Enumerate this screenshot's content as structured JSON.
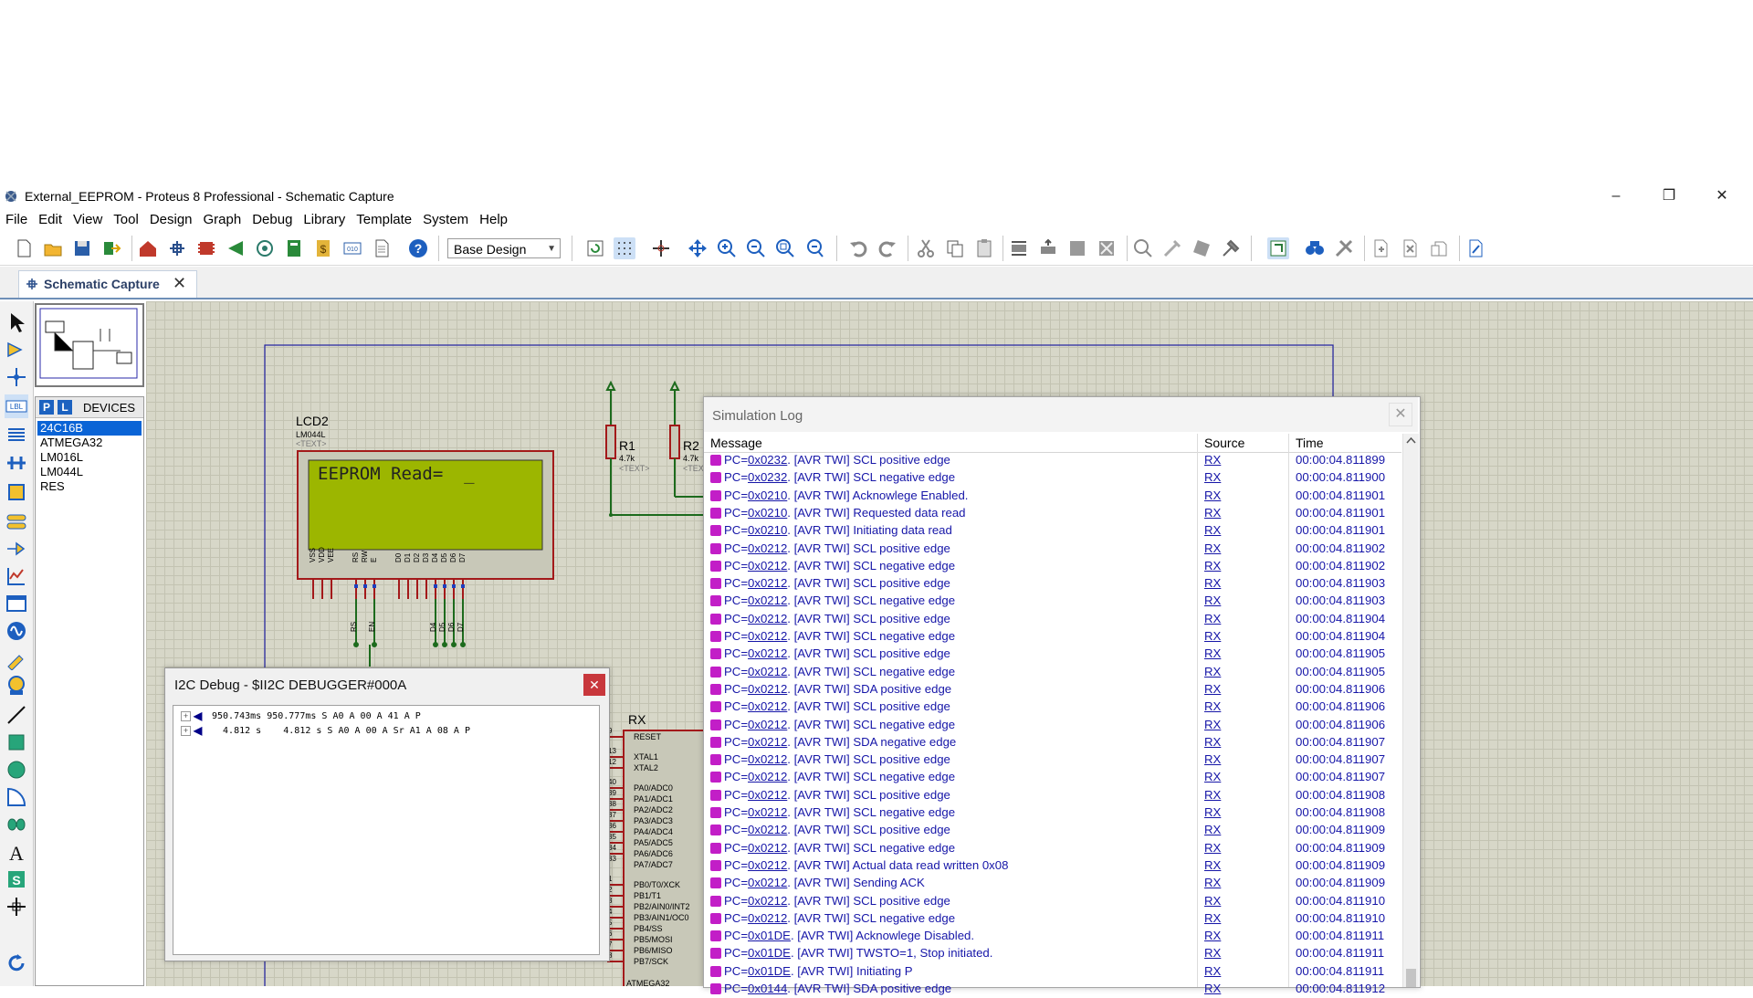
{
  "window": {
    "title": "External_EEPROM - Proteus 8 Professional - Schematic Capture",
    "minimize": "–",
    "restore": "❐",
    "close": "✕"
  },
  "menu": [
    "File",
    "Edit",
    "View",
    "Tool",
    "Design",
    "Graph",
    "Debug",
    "Library",
    "Template",
    "System",
    "Help"
  ],
  "toolbar": {
    "design_select": "Base Design",
    "icons": [
      "new-icon",
      "open-icon",
      "save-icon",
      "import-icon",
      "home-icon",
      "schematic-icon",
      "pcb-icon",
      "gerber-icon",
      "3d-icon",
      "bom-icon",
      "source-code-icon",
      "notes-icon",
      "help-icon",
      "refresh-icon",
      "grid-icon",
      "origin-icon",
      "pan-icon",
      "zoom-in-icon",
      "zoom-out-icon",
      "zoom-all-icon",
      "zoom-area-icon",
      "undo-icon",
      "redo-icon",
      "cut-icon",
      "copy-icon",
      "paste-icon",
      "block-copy-icon",
      "block-move-icon",
      "block-rotate-icon",
      "block-delete-icon",
      "pick-device-icon",
      "make-device-icon",
      "packaging-icon",
      "decompose-icon",
      "wire-autorouter-icon",
      "search-icon",
      "property-assign-icon",
      "new-sheet-icon",
      "delete-sheet-icon",
      "goto-sheet-icon",
      "netlist-icon"
    ]
  },
  "tabs": [
    {
      "label": "Schematic Capture",
      "close": "✕"
    }
  ],
  "devices": {
    "p_label": "P",
    "l_label": "L",
    "header": "DEVICES",
    "items": [
      "24C16B",
      "ATMEGA32",
      "LM016L",
      "LM044L",
      "RES"
    ],
    "selected_index": 0
  },
  "schematic": {
    "lcd": {
      "ref": "LCD2",
      "part": "LM044L",
      "text_placeholder": "<TEXT>",
      "display": "EEPROM Read=  _"
    },
    "lcd_pins": [
      "VSS",
      "VDD",
      "VEE",
      "RS",
      "RW",
      "E",
      "D0",
      "D1",
      "D2",
      "D3",
      "D4",
      "D5",
      "D6",
      "D7"
    ],
    "lcd_nets": [
      "RS",
      "EN",
      "D4",
      "D5",
      "D6",
      "D7"
    ],
    "r1": {
      "ref": "R1",
      "value": "4.7k",
      "text": "<TEXT>"
    },
    "r2": {
      "ref": "R2",
      "value": "4.7k",
      "text": "<TEX"
    },
    "mcu": {
      "net_label": "RX",
      "part": "ATMEGA32",
      "pins": [
        "RESET",
        "XTAL1",
        "XTAL2",
        "PA0/ADC0",
        "PA1/ADC1",
        "PA2/ADC2",
        "PA3/ADC3",
        "PA4/ADC4",
        "PA5/ADC5",
        "PA6/ADC6",
        "PA7/ADC7",
        "PB0/T0/XCK",
        "PB1/T1",
        "PB2/AIN0/INT2",
        "PB3/AIN1/OC0",
        "PB4/SS",
        "PB5/MOSI",
        "PB6/MISO",
        "PB7/SCK"
      ],
      "pin_numbers": [
        "9",
        "13",
        "12",
        "40",
        "39",
        "38",
        "37",
        "36",
        "35",
        "34",
        "33",
        "1",
        "2",
        "3",
        "4",
        "5",
        "6",
        "7",
        "8"
      ]
    }
  },
  "i2c_debug": {
    "title": "I2C Debug - $II2C DEBUGGER#000A",
    "close": "✕",
    "rows": [
      "950.743ms 950.777ms S A0 A 00 A 41 A P",
      "  4.812 s    4.812 s S A0 A 00 A Sr A1 A 08 A P"
    ]
  },
  "simulation_log": {
    "title": "Simulation Log",
    "close": "✕",
    "columns": [
      "Message",
      "Source",
      "Time"
    ],
    "rows": [
      {
        "pc": "0x0232",
        "msg": ". [AVR TWI] SCL positive edge",
        "src": "RX",
        "time": "00:00:04.811899"
      },
      {
        "pc": "0x0232",
        "msg": ". [AVR TWI] SCL negative edge",
        "src": "RX",
        "time": "00:00:04.811900"
      },
      {
        "pc": "0x0210",
        "msg": ". [AVR TWI] Acknowlege Enabled.",
        "src": "RX",
        "time": "00:00:04.811901"
      },
      {
        "pc": "0x0210",
        "msg": ". [AVR TWI] Requested data read",
        "src": "RX",
        "time": "00:00:04.811901"
      },
      {
        "pc": "0x0210",
        "msg": ". [AVR TWI] Initiating data read",
        "src": "RX",
        "time": "00:00:04.811901"
      },
      {
        "pc": "0x0212",
        "msg": ". [AVR TWI] SCL positive edge",
        "src": "RX",
        "time": "00:00:04.811902"
      },
      {
        "pc": "0x0212",
        "msg": ". [AVR TWI] SCL negative edge",
        "src": "RX",
        "time": "00:00:04.811902"
      },
      {
        "pc": "0x0212",
        "msg": ". [AVR TWI] SCL positive edge",
        "src": "RX",
        "time": "00:00:04.811903"
      },
      {
        "pc": "0x0212",
        "msg": ". [AVR TWI] SCL negative edge",
        "src": "RX",
        "time": "00:00:04.811903"
      },
      {
        "pc": "0x0212",
        "msg": ". [AVR TWI] SCL positive edge",
        "src": "RX",
        "time": "00:00:04.811904"
      },
      {
        "pc": "0x0212",
        "msg": ". [AVR TWI] SCL negative edge",
        "src": "RX",
        "time": "00:00:04.811904"
      },
      {
        "pc": "0x0212",
        "msg": ". [AVR TWI] SCL positive edge",
        "src": "RX",
        "time": "00:00:04.811905"
      },
      {
        "pc": "0x0212",
        "msg": ". [AVR TWI] SCL negative edge",
        "src": "RX",
        "time": "00:00:04.811905"
      },
      {
        "pc": "0x0212",
        "msg": ". [AVR TWI] SDA positive edge",
        "src": "RX",
        "time": "00:00:04.811906"
      },
      {
        "pc": "0x0212",
        "msg": ". [AVR TWI] SCL positive edge",
        "src": "RX",
        "time": "00:00:04.811906"
      },
      {
        "pc": "0x0212",
        "msg": ". [AVR TWI] SCL negative edge",
        "src": "RX",
        "time": "00:00:04.811906"
      },
      {
        "pc": "0x0212",
        "msg": ". [AVR TWI] SDA negative edge",
        "src": "RX",
        "time": "00:00:04.811907"
      },
      {
        "pc": "0x0212",
        "msg": ". [AVR TWI] SCL positive edge",
        "src": "RX",
        "time": "00:00:04.811907"
      },
      {
        "pc": "0x0212",
        "msg": ". [AVR TWI] SCL negative edge",
        "src": "RX",
        "time": "00:00:04.811907"
      },
      {
        "pc": "0x0212",
        "msg": ". [AVR TWI] SCL positive edge",
        "src": "RX",
        "time": "00:00:04.811908"
      },
      {
        "pc": "0x0212",
        "msg": ". [AVR TWI] SCL negative edge",
        "src": "RX",
        "time": "00:00:04.811908"
      },
      {
        "pc": "0x0212",
        "msg": ". [AVR TWI] SCL positive edge",
        "src": "RX",
        "time": "00:00:04.811909"
      },
      {
        "pc": "0x0212",
        "msg": ". [AVR TWI] SCL negative edge",
        "src": "RX",
        "time": "00:00:04.811909"
      },
      {
        "pc": "0x0212",
        "msg": ". [AVR TWI] Actual data read written 0x08",
        "src": "RX",
        "time": "00:00:04.811909"
      },
      {
        "pc": "0x0212",
        "msg": ". [AVR TWI] Sending ACK",
        "src": "RX",
        "time": "00:00:04.811909"
      },
      {
        "pc": "0x0212",
        "msg": ". [AVR TWI] SCL positive edge",
        "src": "RX",
        "time": "00:00:04.811910"
      },
      {
        "pc": "0x0212",
        "msg": ". [AVR TWI] SCL negative edge",
        "src": "RX",
        "time": "00:00:04.811910"
      },
      {
        "pc": "0x01DE",
        "msg": ". [AVR TWI] Acknowlege Disabled.",
        "src": "RX",
        "time": "00:00:04.811911"
      },
      {
        "pc": "0x01DE",
        "msg": ". [AVR TWI] TWSTO=1, Stop initiated.",
        "src": "RX",
        "time": "00:00:04.811911"
      },
      {
        "pc": "0x01DE",
        "msg": ". [AVR TWI] Initiating P",
        "src": "RX",
        "time": "00:00:04.811911"
      },
      {
        "pc": "0x0144",
        "msg": ". [AVR TWI] SDA positive edge",
        "src": "RX",
        "time": "00:00:04.811912"
      }
    ]
  },
  "colors": {
    "lcd_screen": "#9cb600",
    "component_outline": "#a3191a",
    "wire": "#1d6b1d",
    "log_text": "#1616a8",
    "log_icon": "#c21ec7",
    "selection": "#0a64d6"
  }
}
